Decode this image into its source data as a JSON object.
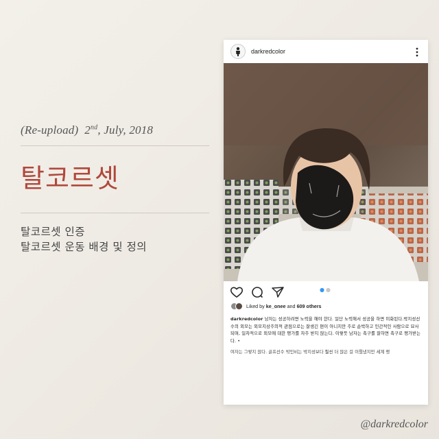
{
  "left_panel": {
    "date_prefix": "(Re-upload)",
    "date_day": "2",
    "date_suffix": "nd",
    "date_rest": ", July, 2018",
    "title": "탈코르셋",
    "subtitles": [
      "탈코르셋 인증",
      "탈코르셋 운동 배경 및 정의"
    ]
  },
  "post": {
    "username": "darkredcolor",
    "more_icon": "more-vertical-icon",
    "carousel_dots": 2,
    "likes": {
      "prefix": "Liked by",
      "user": "ke_onee",
      "and": "and",
      "others": "609 others"
    },
    "caption_user": "darkredcolor",
    "caption_text": "남자는 성공하려면 노력을 해야 한다. 일단 노력해서 성공을 하면 미화된다.박지성선수의 외모는 외모지상주의적 관점으로는 잘생긴 편이 아니지만 주로 순박하고 인간적인 사람으로 묘사되며, 일차적으로 외모에 대한 평가를 자주 받지 않는다. 이렇듯 남자는 축구를 잘하면 축구로 평가받는다. •",
    "caption_cut": "여자는 그렇지 않다. 골프선수 박인비는 박지성보다 훨씬 더 많은 걸 이뤘냈지만 세계 랭"
  },
  "watermark": "@darkredcolor",
  "colors": {
    "accent": "#b0483b",
    "background": "#efebe5",
    "carousel_active": "#3897f0"
  }
}
